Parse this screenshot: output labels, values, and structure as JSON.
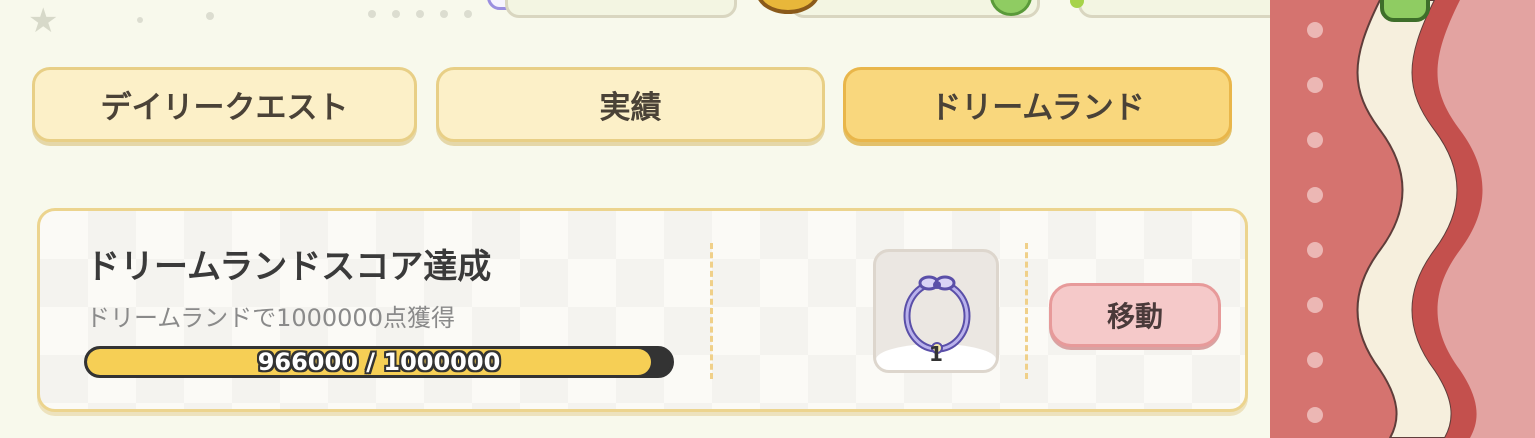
{
  "tabs": {
    "daily": "デイリークエスト",
    "achievements": "実績",
    "dreamland": "ドリームランド",
    "active": "dreamland"
  },
  "quest": {
    "title": "ドリームランドスコア達成",
    "description": "ドリームランドで1000000点獲得",
    "progress_text": "966000 / 1000000",
    "progress_current": 966000,
    "progress_target": 1000000,
    "reward_icon": "ring-charm-icon",
    "reward_count": "1",
    "move_button": "移動"
  },
  "colors": {
    "background": "#f8f9ec",
    "tab_inactive": "#fcf0c8",
    "tab_active": "#f9d77d",
    "progress_fill": "#f6cf55",
    "move_button": "#f5c9c9",
    "curtain": "#d5736f"
  }
}
